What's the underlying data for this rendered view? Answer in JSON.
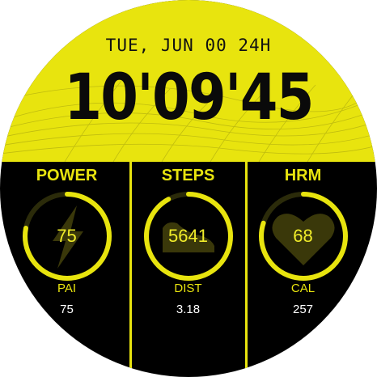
{
  "date": "TUE, JUN 00 24H",
  "time": "10'09'45",
  "colors": {
    "accent": "#e8e40e",
    "background": "#000000",
    "text": "#ffffff"
  },
  "widgets": [
    {
      "title": "POWER",
      "value": "75",
      "icon": "lightning-icon",
      "progress": 0.78,
      "sub_label": "PAI",
      "sub_value": "75"
    },
    {
      "title": "STEPS",
      "value": "5641",
      "icon": "shoe-icon",
      "progress": 0.92,
      "sub_label": "DIST",
      "sub_value": "3.18"
    },
    {
      "title": "HRM",
      "value": "68",
      "icon": "heart-icon",
      "progress": 0.8,
      "sub_label": "CAL",
      "sub_value": "257"
    }
  ]
}
